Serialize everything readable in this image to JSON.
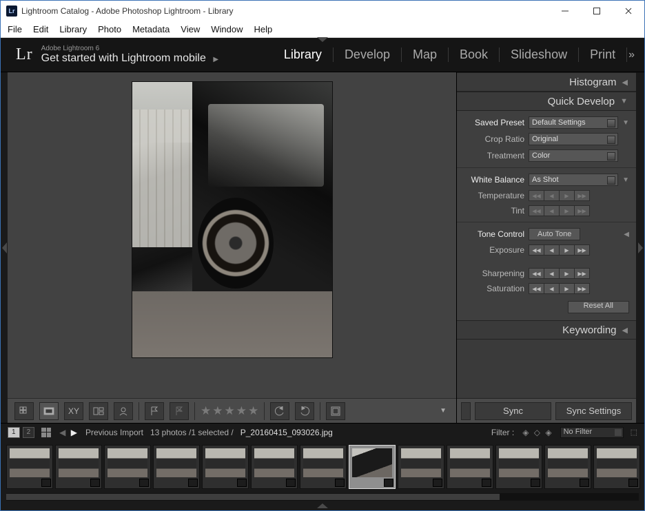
{
  "window": {
    "title": "Lightroom Catalog - Adobe Photoshop Lightroom - Library"
  },
  "menubar": [
    "File",
    "Edit",
    "Library",
    "Photo",
    "Metadata",
    "View",
    "Window",
    "Help"
  ],
  "identity": {
    "logo": "Lr",
    "subtitle": "Adobe Lightroom 6",
    "tagline": "Get started with Lightroom mobile"
  },
  "modules": [
    "Library",
    "Develop",
    "Map",
    "Book",
    "Slideshow",
    "Print"
  ],
  "active_module": "Library",
  "panels": {
    "histogram": "Histogram",
    "quick_develop": "Quick Develop",
    "keywording": "Keywording",
    "saved_preset": {
      "label": "Saved Preset",
      "value": "Default Settings"
    },
    "crop_ratio": {
      "label": "Crop Ratio",
      "value": "Original"
    },
    "treatment": {
      "label": "Treatment",
      "value": "Color"
    },
    "white_balance": {
      "label": "White Balance",
      "value": "As Shot"
    },
    "temperature": "Temperature",
    "tint": "Tint",
    "tone_control": "Tone Control",
    "auto_tone": "Auto Tone",
    "exposure": "Exposure",
    "sharpening": "Sharpening",
    "saturation": "Saturation",
    "reset_all": "Reset All"
  },
  "sync": {
    "sync": "Sync",
    "settings": "Sync Settings"
  },
  "filmstrip": {
    "source": "Previous Import",
    "count": "13 photos /1 selected /",
    "filename": "P_20160415_093026.jpg",
    "filter_label": "Filter :",
    "filter_value": "No Filter",
    "mon1": "1",
    "mon2": "2"
  }
}
